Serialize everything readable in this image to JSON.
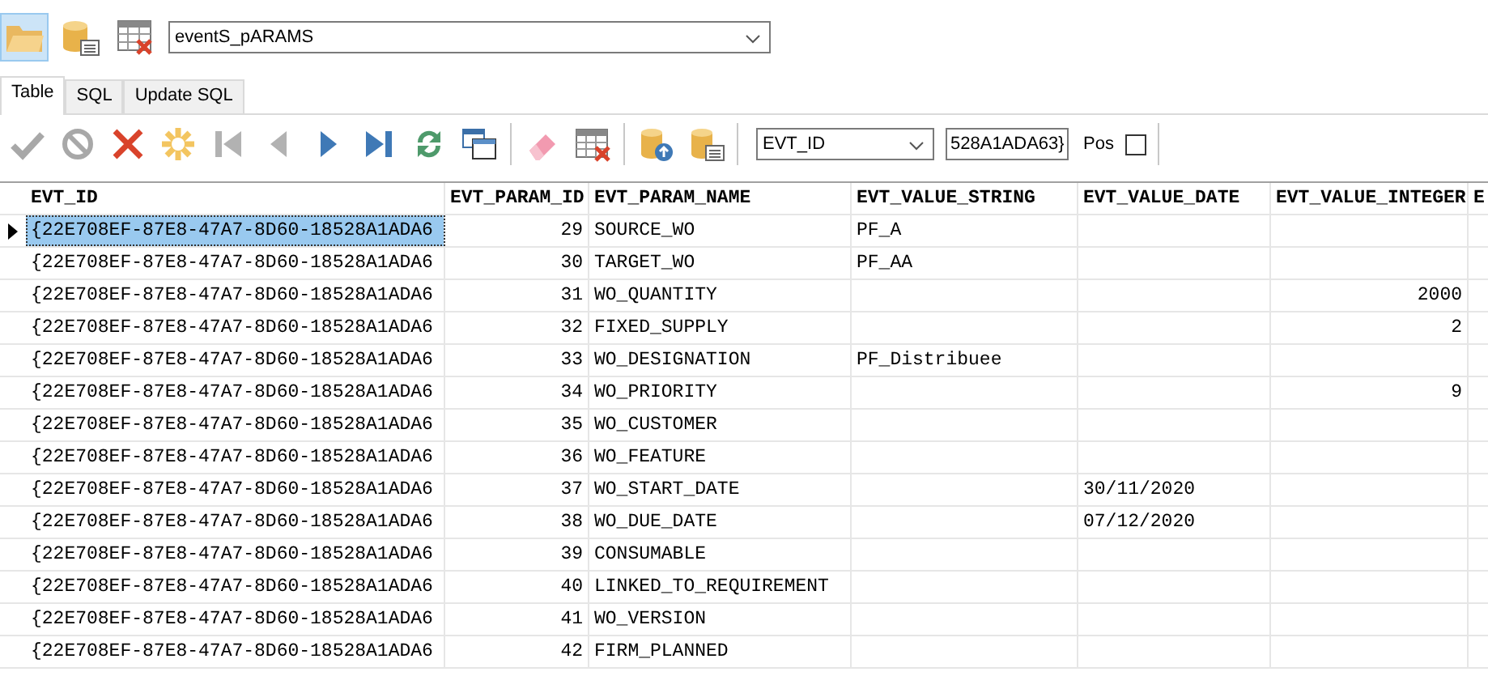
{
  "top_toolbar": [
    {
      "kind": "folder",
      "selected": true
    },
    {
      "kind": "database",
      "selected": false
    },
    {
      "kind": "table-delete",
      "selected": false
    }
  ],
  "table_selector": {
    "value": "eventS_pARAMS"
  },
  "tabs": [
    {
      "label": "Table",
      "selected": true
    },
    {
      "label": "SQL",
      "selected": false
    },
    {
      "label": "Update SQL",
      "selected": false
    }
  ],
  "nav_toolbar": [
    {
      "kind": "check",
      "disabled": true
    },
    {
      "kind": "cancel",
      "disabled": true
    },
    {
      "kind": "delete",
      "disabled": false
    },
    {
      "kind": "insert",
      "disabled": false
    },
    {
      "kind": "first",
      "disabled": true
    },
    {
      "kind": "prior",
      "disabled": true
    },
    {
      "kind": "next",
      "disabled": false
    },
    {
      "kind": "last",
      "disabled": false
    },
    {
      "kind": "refresh",
      "disabled": false
    },
    {
      "kind": "windows",
      "disabled": false
    },
    {
      "kind": "separator"
    },
    {
      "kind": "eraser",
      "disabled": false
    },
    {
      "kind": "table-delete",
      "disabled": false
    },
    {
      "kind": "separator"
    },
    {
      "kind": "db-upload",
      "disabled": false
    },
    {
      "kind": "db-list",
      "disabled": false
    },
    {
      "kind": "separator"
    }
  ],
  "search": {
    "field": "EVT_ID",
    "value": "528A1ADA63}",
    "pos_label": "Pos",
    "pos_checked": false
  },
  "table": {
    "columns": [
      "EVT_ID",
      "EVT_PARAM_ID",
      "EVT_PARAM_NAME",
      "EVT_VALUE_STRING",
      "EVT_VALUE_DATE",
      "EVT_VALUE_INTEGER",
      "E"
    ],
    "rows": [
      {
        "selected": true,
        "cells": [
          "{22E708EF-87E8-47A7-8D60-18528A1ADA6",
          "29",
          "SOURCE_WO",
          "PF_A",
          "",
          ""
        ]
      },
      {
        "selected": false,
        "cells": [
          "{22E708EF-87E8-47A7-8D60-18528A1ADA6",
          "30",
          "TARGET_WO",
          "PF_AA",
          "",
          ""
        ]
      },
      {
        "selected": false,
        "cells": [
          "{22E708EF-87E8-47A7-8D60-18528A1ADA6",
          "31",
          "WO_QUANTITY",
          "",
          "",
          "2000"
        ]
      },
      {
        "selected": false,
        "cells": [
          "{22E708EF-87E8-47A7-8D60-18528A1ADA6",
          "32",
          "FIXED_SUPPLY",
          "",
          "",
          "2"
        ]
      },
      {
        "selected": false,
        "cells": [
          "{22E708EF-87E8-47A7-8D60-18528A1ADA6",
          "33",
          "WO_DESIGNATION",
          "PF_Distribuee",
          "",
          ""
        ]
      },
      {
        "selected": false,
        "cells": [
          "{22E708EF-87E8-47A7-8D60-18528A1ADA6",
          "34",
          "WO_PRIORITY",
          "",
          "",
          "9"
        ]
      },
      {
        "selected": false,
        "cells": [
          "{22E708EF-87E8-47A7-8D60-18528A1ADA6",
          "35",
          "WO_CUSTOMER",
          "",
          "",
          ""
        ]
      },
      {
        "selected": false,
        "cells": [
          "{22E708EF-87E8-47A7-8D60-18528A1ADA6",
          "36",
          "WO_FEATURE",
          "",
          "",
          ""
        ]
      },
      {
        "selected": false,
        "cells": [
          "{22E708EF-87E8-47A7-8D60-18528A1ADA6",
          "37",
          "WO_START_DATE",
          "",
          "30/11/2020",
          ""
        ]
      },
      {
        "selected": false,
        "cells": [
          "{22E708EF-87E8-47A7-8D60-18528A1ADA6",
          "38",
          "WO_DUE_DATE",
          "",
          "07/12/2020",
          ""
        ]
      },
      {
        "selected": false,
        "cells": [
          "{22E708EF-87E8-47A7-8D60-18528A1ADA6",
          "39",
          "CONSUMABLE",
          "",
          "",
          ""
        ]
      },
      {
        "selected": false,
        "cells": [
          "{22E708EF-87E8-47A7-8D60-18528A1ADA6",
          "40",
          "LINKED_TO_REQUIREMENT",
          "",
          "",
          ""
        ]
      },
      {
        "selected": false,
        "cells": [
          "{22E708EF-87E8-47A7-8D60-18528A1ADA6",
          "41",
          "WO_VERSION",
          "",
          "",
          ""
        ]
      },
      {
        "selected": false,
        "cells": [
          "{22E708EF-87E8-47A7-8D60-18528A1ADA6",
          "42",
          "FIRM_PLANNED",
          "",
          "",
          ""
        ]
      }
    ]
  }
}
